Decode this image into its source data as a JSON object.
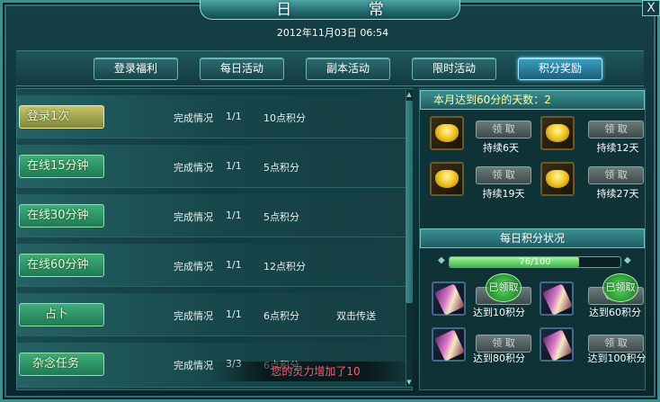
{
  "window": {
    "title": "日 常",
    "close_glyph": "X",
    "datetime": "2012年11月03日  06:54"
  },
  "tabs": [
    {
      "label": "登录福利",
      "active": false
    },
    {
      "label": "每日活动",
      "active": false
    },
    {
      "label": "副本活动",
      "active": false
    },
    {
      "label": "限时活动",
      "active": false
    },
    {
      "label": "积分奖励",
      "active": true
    }
  ],
  "tasks": [
    {
      "name": "登录1次",
      "status": "完成情况",
      "progress": "1/1",
      "points": "10点积分",
      "extra": ""
    },
    {
      "name": "在线15分钟",
      "status": "完成情况",
      "progress": "1/1",
      "points": "5点积分",
      "extra": ""
    },
    {
      "name": "在线30分钟",
      "status": "完成情况",
      "progress": "1/1",
      "points": "5点积分",
      "extra": ""
    },
    {
      "name": "在线60分钟",
      "status": "完成情况",
      "progress": "1/1",
      "points": "12点积分",
      "extra": ""
    },
    {
      "name": "占卜",
      "status": "完成情况",
      "progress": "1/1",
      "points": "6点积分",
      "extra": "双击传送"
    },
    {
      "name": "杂念任务",
      "status": "完成情况",
      "progress": "3/3",
      "points": "6点积分",
      "extra": ""
    }
  ],
  "toast": "您的灵力增加了10",
  "monthly": {
    "header": "本月达到60分的天数：2",
    "rewards": [
      {
        "claim_label": "领 取",
        "caption": "持续6天",
        "icon": "gold-ingot-icon"
      },
      {
        "claim_label": "领 取",
        "caption": "持续12天",
        "icon": "gold-ingot-icon"
      },
      {
        "claim_label": "领 取",
        "caption": "持续19天",
        "icon": "gold-ingot-icon"
      },
      {
        "claim_label": "领 取",
        "caption": "持续27天",
        "icon": "gold-ingot-icon"
      }
    ]
  },
  "daily": {
    "header": "每日积分状况",
    "progress_text": "76/100",
    "progress_value": 76,
    "progress_max": 100,
    "rewards": [
      {
        "claim_label": "领 取",
        "caption": "达到10积分",
        "claimed": true,
        "badge": "已领取",
        "icon": "scroll-icon"
      },
      {
        "claim_label": "领 取",
        "caption": "达到60积分",
        "claimed": true,
        "badge": "已领取",
        "icon": "scroll-icon"
      },
      {
        "claim_label": "领 取",
        "caption": "达到80积分",
        "claimed": false,
        "badge": "",
        "icon": "scroll-icon"
      },
      {
        "claim_label": "领 取",
        "caption": "达到100积分",
        "claimed": false,
        "badge": "",
        "icon": "scroll-icon"
      }
    ]
  },
  "colors": {
    "accent_teal": "#3f8d8f",
    "header_yellow": "#ffff9c",
    "toast_red": "#ff5b73",
    "bar_green": "#41b64c"
  }
}
